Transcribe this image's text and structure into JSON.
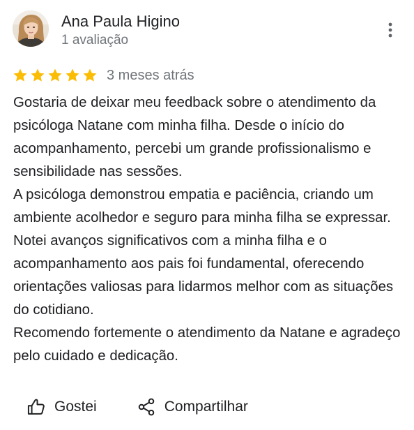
{
  "review": {
    "author": {
      "name": "Ana Paula Higino",
      "meta": "1 avaliação",
      "avatar_icon": "user-photo"
    },
    "more_icon": "more-vert-icon",
    "rating": 5,
    "max_rating": 5,
    "star_color": "#fbbc04",
    "date": "3 meses atrás",
    "text": "Gostaria de deixar meu feedback sobre o atendimento da psicóloga Natane com minha filha. Desde o início do acompanhamento, percebi um grande profissionalismo e sensibilidade nas sessões.\nA psicóloga demonstrou empatia e paciência, criando um ambiente acolhedor e seguro para minha filha se expressar. Notei avanços significativos com a minha filha e o acompanhamento aos pais foi fundamental, oferecendo orientações valiosas para lidarmos melhor com as situações do cotidiano.\nRecomendo fortemente o atendimento da Natane e agradeço pelo cuidado e dedicação."
  },
  "actions": {
    "like_label": "Gostei",
    "like_icon": "thumbs-up-icon",
    "share_label": "Compartilhar",
    "share_icon": "share-icon"
  }
}
